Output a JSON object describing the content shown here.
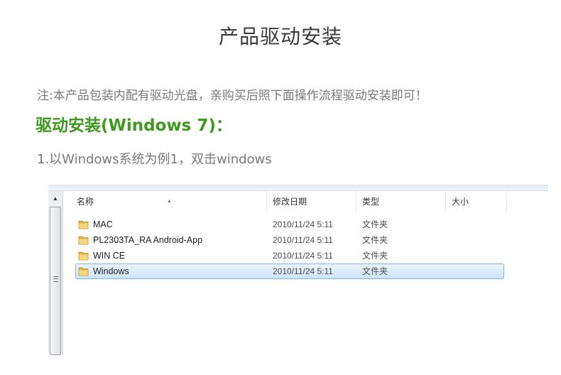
{
  "page": {
    "title": "产品驱动安装",
    "note": "注:本产品包装内配有驱动光盘，亲购买后照下面操作流程驱动安装即可！",
    "section_heading": "驱动安装(Windows 7)：",
    "step1": "1.以Windows系统为例1，双击windows"
  },
  "colors": {
    "heading_green": "#3e9a1f",
    "text_gray": "#7a7a7a",
    "selection_border": "#7eb4ea",
    "folder_yellow": "#e9c45a"
  },
  "explorer": {
    "columns": {
      "name": "名称",
      "date": "修改日期",
      "type": "类型",
      "size": "大小"
    },
    "rows": [
      {
        "name": "MAC",
        "date": "2010/11/24 5:11",
        "type": "文件夹",
        "icon": "folder-icon",
        "selected": false
      },
      {
        "name": "PL2303TA_RA Android-App",
        "date": "2010/11/24 5:11",
        "type": "文件夹",
        "icon": "folder-icon",
        "selected": false
      },
      {
        "name": "WIN CE",
        "date": "2010/11/24 5:11",
        "type": "文件夹",
        "icon": "folder-icon",
        "selected": false
      },
      {
        "name": "Windows",
        "date": "2010/11/24 5:11",
        "type": "文件夹",
        "icon": "folder-icon",
        "selected": true
      }
    ]
  }
}
